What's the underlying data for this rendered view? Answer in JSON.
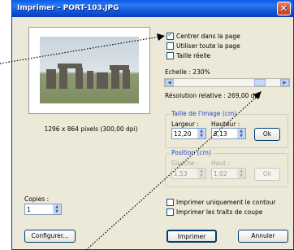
{
  "title": "Imprimer - PORT-103.JPG",
  "image_info": "1296 x 864 pixels (300,00 dpi)",
  "options": {
    "center_label": "Centrer dans la page",
    "center_checked": true,
    "full_page_label": "Utiliser toute la page",
    "full_page_checked": false,
    "real_size_label": "Taille réelle",
    "real_size_checked": false
  },
  "scale_label": "Echelle : 230%",
  "resolution_label": "Résolution relative : 269,00 dpi",
  "image_size": {
    "group_title": "Taille de l'image (cm)",
    "width_label": "Largeur :",
    "height_label": "Hauteur :",
    "width_value": "12,20",
    "height_value": "8,13",
    "ok_label": "Ok"
  },
  "position": {
    "group_title": "Position (cm)",
    "left_label": "Gauche :",
    "top_label": "Haut :",
    "left_value": "1,53",
    "top_value": "1,02",
    "ok_label": "Ok"
  },
  "contour_label": "Imprimer uniquement le contour",
  "crop_marks_label": "Imprimer les traits de coupe",
  "copies_label": "Copies :",
  "copies_value": "1",
  "buttons": {
    "configure": "Configurer...",
    "print": "Imprimer",
    "cancel": "Annuler"
  }
}
